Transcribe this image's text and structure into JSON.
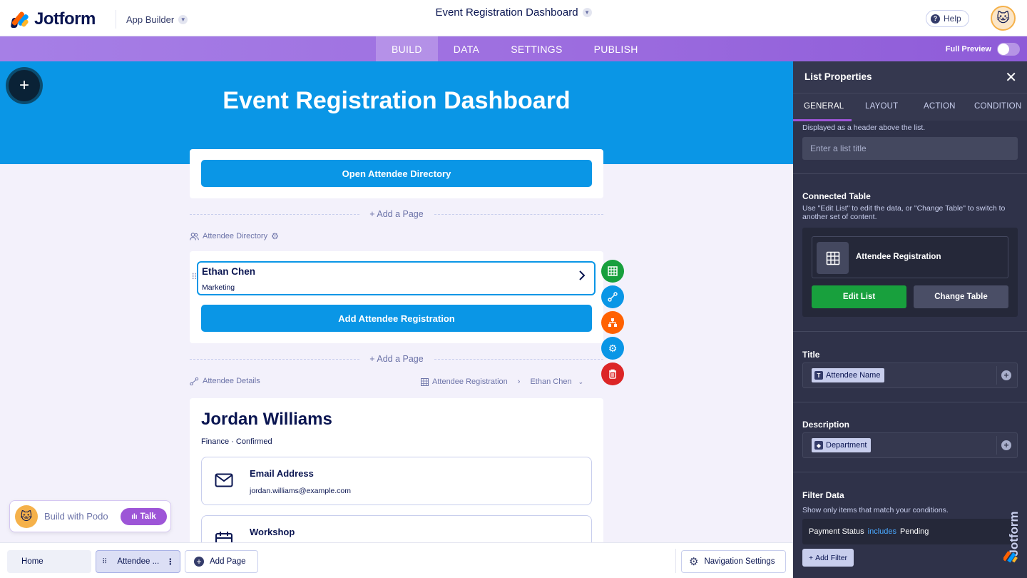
{
  "header": {
    "brand": "Jotform",
    "app_builder_label": "App Builder",
    "app_title": "Event Registration Dashboard",
    "help_label": "Help"
  },
  "nav": {
    "tabs": [
      {
        "label": "BUILD",
        "active": true
      },
      {
        "label": "DATA",
        "active": false
      },
      {
        "label": "SETTINGS",
        "active": false
      },
      {
        "label": "PUBLISH",
        "active": false
      }
    ],
    "full_preview_label": "Full Preview"
  },
  "canvas": {
    "hero_title": "Event Registration Dashboard",
    "open_directory_button": "Open Attendee Directory",
    "add_page_label": "+ Add a Page",
    "directory_page_label": "Attendee Directory",
    "list_item": {
      "title": "Ethan Chen",
      "subtitle": "Marketing"
    },
    "add_registration_button": "Add Attendee Registration",
    "details_page_label": "Attendee Details",
    "breadcrumb_table": "Attendee Registration",
    "breadcrumb_record": "Ethan Chen",
    "detail": {
      "name": "Jordan Williams",
      "subtitle": "Finance · Confirmed",
      "fields": [
        {
          "label": "Email Address",
          "value": "jordan.williams@example.com",
          "icon": "envelope-icon"
        },
        {
          "label": "Workshop",
          "value": "",
          "icon": "calendar-icon"
        }
      ]
    },
    "side_tools": [
      {
        "name": "table-tool",
        "color": "#18a03d"
      },
      {
        "name": "link-tool",
        "color": "#0a96e6"
      },
      {
        "name": "hierarchy-tool",
        "color": "#ff6100"
      },
      {
        "name": "settings-tool",
        "color": "#0a96e6"
      },
      {
        "name": "delete-tool",
        "color": "#dc2626"
      }
    ]
  },
  "podo": {
    "text": "Build with Podo",
    "talk_label": "Talk"
  },
  "bottom_bar": {
    "home_label": "Home",
    "attendee_label": "Attendee ...",
    "add_page_label": "Add Page",
    "navigation_settings_label": "Navigation Settings"
  },
  "panel": {
    "title": "List Properties",
    "tabs": [
      "GENERAL",
      "LAYOUT",
      "ACTION",
      "CONDITION"
    ],
    "title_hint": "Displayed as a header above the list.",
    "title_placeholder": "Enter a list title",
    "connected_table_heading": "Connected Table",
    "connected_table_hint": "Use \"Edit List\" to edit the data, or \"Change Table\" to switch to another set of content.",
    "connected_table_name": "Attendee Registration",
    "edit_list_label": "Edit List",
    "change_table_label": "Change Table",
    "title_field_heading": "Title",
    "title_tag": "Attendee Name",
    "description_heading": "Description",
    "description_tag": "Department",
    "filter_heading": "Filter Data",
    "filter_hint": "Show only items that match your conditions.",
    "filter_field": "Payment Status",
    "filter_operator": "includes",
    "filter_value": "Pending",
    "add_filter_label": "Add Filter",
    "watermark": "Jotform"
  },
  "colors": {
    "hero_blue": "#0a96e6",
    "nav_purple": "#9e6fe0",
    "panel_bg": "#2f3249",
    "green": "#18a03d",
    "filter_operator_blue": "#4aa8ff"
  }
}
